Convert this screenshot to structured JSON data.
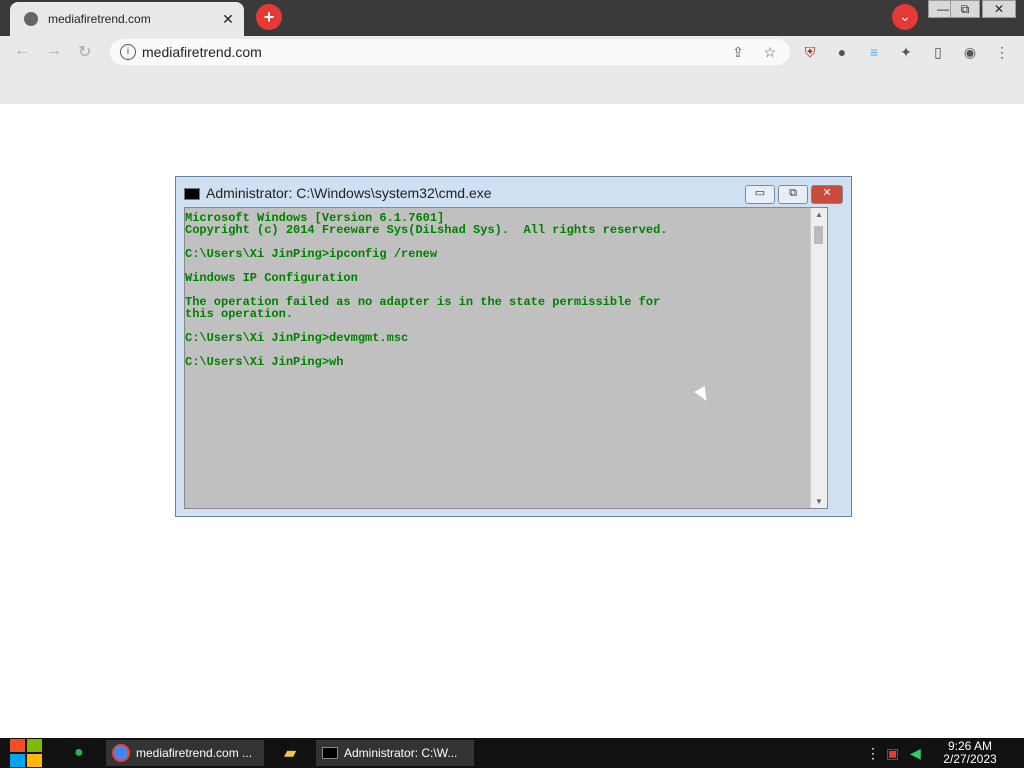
{
  "browser": {
    "tab_title": "mediafiretrend.com",
    "tab_close": "✕",
    "new_tab": "+",
    "tab_search": "⌄",
    "url": "mediafiretrend.com"
  },
  "window_controls": {
    "minimize": "—",
    "restore": "⧉",
    "close": "✕"
  },
  "cmd": {
    "title": "Administrator: C:\\Windows\\system32\\cmd.exe",
    "output": "Microsoft Windows [Version 6.1.7601]\nCopyright (c) 2014 Freeware Sys(DiLshad Sys).  All rights reserved.\n\nC:\\Users\\Xi JinPing>ipconfig /renew\n\nWindows IP Configuration\n\nThe operation failed as no adapter is in the state permissible for\nthis operation.\n\nC:\\Users\\Xi JinPing>devmgmt.msc\n\nC:\\Users\\Xi JinPing>wh"
  },
  "taskbar": {
    "chrome_task": "mediafiretrend.com ...",
    "cmd_task": "Administrator: C:\\W...",
    "time": "9:26 AM",
    "date": "2/27/2023"
  },
  "colors": {
    "console_text": "#008000",
    "console_bg": "#c0c0c0",
    "accent_red": "#e53935"
  }
}
